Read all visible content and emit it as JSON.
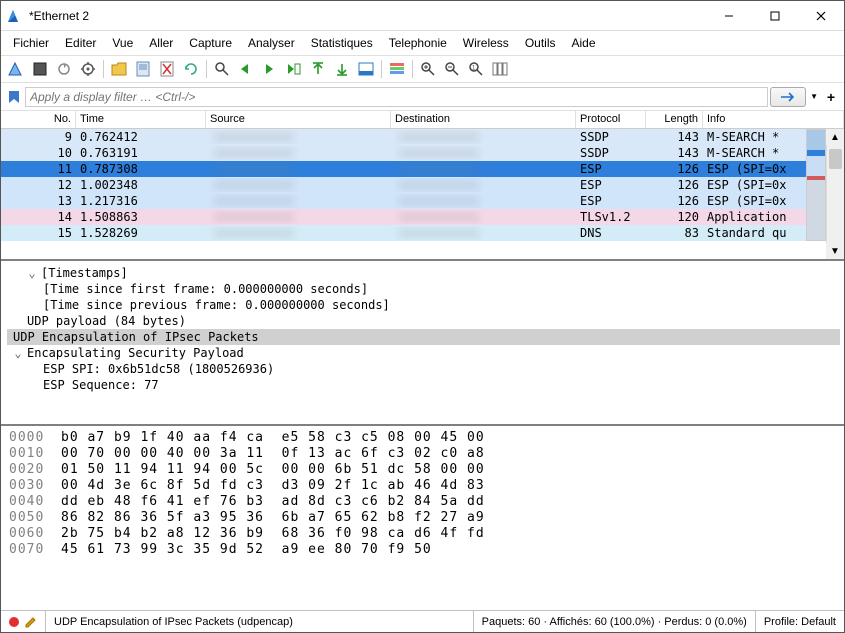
{
  "titlebar": {
    "title": "*Ethernet 2"
  },
  "menu": [
    "Fichier",
    "Editer",
    "Vue",
    "Aller",
    "Capture",
    "Analyser",
    "Statistiques",
    "Telephonie",
    "Wireless",
    "Outils",
    "Aide"
  ],
  "filter": {
    "placeholder": "Apply a display filter … <Ctrl-/>"
  },
  "columns": {
    "no": "No.",
    "time": "Time",
    "src": "Source",
    "dst": "Destination",
    "proto": "Protocol",
    "len": "Length",
    "info": "Info"
  },
  "packets": [
    {
      "no": "9",
      "time": "0.762412",
      "proto": "SSDP",
      "len": "143",
      "info": "M-SEARCH * ",
      "cls": "ssdp"
    },
    {
      "no": "10",
      "time": "0.763191",
      "proto": "SSDP",
      "len": "143",
      "info": "M-SEARCH * ",
      "cls": "ssdp"
    },
    {
      "no": "11",
      "time": "0.787308",
      "proto": "ESP",
      "len": "126",
      "info": "ESP (SPI=0x",
      "cls": "esp",
      "sel": true
    },
    {
      "no": "12",
      "time": "1.002348",
      "proto": "ESP",
      "len": "126",
      "info": "ESP (SPI=0x",
      "cls": "esp"
    },
    {
      "no": "13",
      "time": "1.217316",
      "proto": "ESP",
      "len": "126",
      "info": "ESP (SPI=0x",
      "cls": "esp"
    },
    {
      "no": "14",
      "time": "1.508863",
      "proto": "TLSv1.2",
      "len": "120",
      "info": "Application",
      "cls": "tls"
    },
    {
      "no": "15",
      "time": "1.528269",
      "proto": "DNS",
      "len": "83",
      "info": "Standard qu",
      "cls": "dns"
    }
  ],
  "detail": {
    "timestamps_label": "[Timestamps]",
    "ts_first": "[Time since first frame: 0.000000000 seconds]",
    "ts_prev": "[Time since previous frame: 0.000000000 seconds]",
    "udp_payload": "UDP payload (84 bytes)",
    "udp_encap": "UDP Encapsulation of IPsec Packets",
    "esp_header": "Encapsulating Security Payload",
    "esp_spi": "ESP SPI: 0x6b51dc58 (1800526936)",
    "esp_seq": "ESP Sequence: 77"
  },
  "hex": [
    {
      "off": "0000",
      "b": "b0 a7 b9 1f 40 aa f4 ca  e5 58 c3 c5 08 00 45 00"
    },
    {
      "off": "0010",
      "b": "00 70 00 00 40 00 3a 11  0f 13 ac 6f c3 02 c0 a8"
    },
    {
      "off": "0020",
      "b": "01 50 11 94 11 94 00 5c  00 00 6b 51 dc 58 00 00"
    },
    {
      "off": "0030",
      "b": "00 4d 3e 6c 8f 5d fd c3  d3 09 2f 1c ab 46 4d 83"
    },
    {
      "off": "0040",
      "b": "dd eb 48 f6 41 ef 76 b3  ad 8d c3 c6 b2 84 5a dd"
    },
    {
      "off": "0050",
      "b": "86 82 86 36 5f a3 95 36  6b a7 65 62 b8 f2 27 a9"
    },
    {
      "off": "0060",
      "b": "2b 75 b4 b2 a8 12 36 b9  68 36 f0 98 ca d6 4f fd"
    },
    {
      "off": "0070",
      "b": "45 61 73 99 3c 35 9d 52  a9 ee 80 70 f9 50"
    }
  ],
  "status": {
    "desc": "UDP Encapsulation of IPsec Packets (udpencap)",
    "pkts": "Paquets: 60 · Affichés: 60 (100.0%) · Perdus: 0 (0.0%)",
    "profile": "Profile: Default"
  },
  "twisty_open": "⌄",
  "twisty_closed": "›"
}
